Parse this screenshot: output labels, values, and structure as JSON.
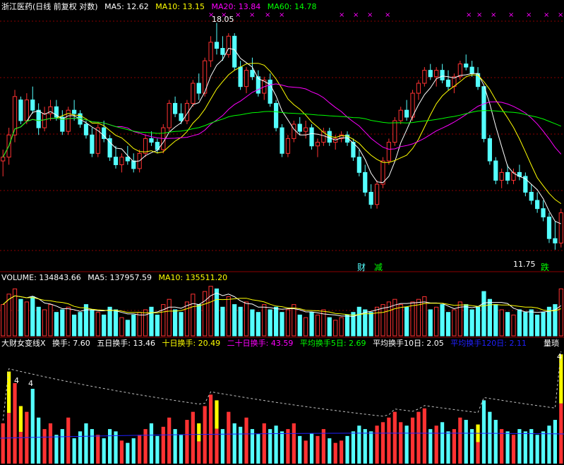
{
  "colors": {
    "background": "#000000",
    "bull": "#ff3232",
    "bear": "#54ffff",
    "white": "#ffffff",
    "yellow": "#ffff00",
    "magenta": "#ff00ff",
    "green": "#00ff00",
    "blue": "#2020ff",
    "grid": "#8b0000"
  },
  "main": {
    "title": "浙江医药(日线 前复权 对数)",
    "ma5": "MA5: 12.62",
    "ma10": "MA10: 13.15",
    "ma20": "MA20: 13.84",
    "ma60": "MA60: 14.78",
    "high_label": "18.05",
    "low_label": "11.75",
    "tag_cai": "财",
    "tag_jian": "减",
    "tag_die": "跌"
  },
  "volume": {
    "label": "VOLUME: 134843.66",
    "ma5": "MA5: 137957.59",
    "ma10": "MA10: 135511.20"
  },
  "turnover": {
    "title": "大财女变线X",
    "t1": "换手: 7.60",
    "t5": "五日换手: 13.46",
    "t10": "十日换手: 20.49",
    "t20": "二十日换手: 43.59",
    "avg5": "平均换手5日: 2.69",
    "avg10": "平均换手10日: 2.05",
    "avg120": "平均换手120日: 2.11",
    "right_label": "量琐",
    "mark_4": "4"
  },
  "chart_data": {
    "type": "candlestick",
    "price_high": 18.05,
    "price_low": 11.75,
    "candles": [
      [
        13.9,
        14.2,
        13.5,
        14.0
      ],
      [
        14.0,
        14.8,
        13.8,
        14.6
      ],
      [
        14.6,
        15.9,
        14.4,
        15.7
      ],
      [
        15.6,
        15.7,
        14.9,
        15.0
      ],
      [
        15.0,
        15.8,
        14.9,
        15.6
      ],
      [
        15.6,
        16.0,
        15.2,
        15.3
      ],
      [
        15.3,
        15.5,
        14.6,
        14.8
      ],
      [
        14.8,
        15.4,
        14.7,
        15.2
      ],
      [
        15.2,
        15.6,
        15.0,
        15.4
      ],
      [
        15.4,
        15.6,
        15.0,
        15.1
      ],
      [
        15.1,
        15.3,
        14.6,
        14.7
      ],
      [
        14.7,
        15.4,
        14.6,
        15.3
      ],
      [
        15.3,
        15.6,
        15.0,
        15.2
      ],
      [
        15.2,
        15.3,
        14.8,
        14.9
      ],
      [
        14.9,
        15.0,
        14.5,
        14.6
      ],
      [
        14.6,
        14.8,
        14.0,
        14.1
      ],
      [
        14.1,
        14.9,
        14.0,
        14.8
      ],
      [
        14.8,
        15.0,
        14.4,
        14.5
      ],
      [
        14.5,
        14.6,
        13.9,
        14.0
      ],
      [
        14.0,
        14.3,
        13.7,
        13.8
      ],
      [
        13.8,
        14.1,
        13.6,
        14.0
      ],
      [
        14.0,
        14.3,
        13.8,
        13.9
      ],
      [
        13.9,
        14.1,
        13.6,
        13.7
      ],
      [
        13.7,
        14.2,
        13.6,
        14.1
      ],
      [
        14.1,
        14.6,
        14.0,
        14.5
      ],
      [
        14.5,
        14.7,
        14.3,
        14.4
      ],
      [
        14.4,
        14.5,
        14.1,
        14.2
      ],
      [
        14.2,
        14.9,
        14.1,
        14.8
      ],
      [
        14.8,
        15.6,
        14.7,
        15.5
      ],
      [
        15.5,
        15.7,
        15.1,
        15.2
      ],
      [
        15.2,
        15.5,
        14.9,
        15.0
      ],
      [
        15.0,
        15.6,
        14.9,
        15.5
      ],
      [
        15.5,
        16.2,
        15.4,
        16.1
      ],
      [
        16.1,
        16.4,
        15.6,
        15.8
      ],
      [
        15.8,
        16.9,
        15.7,
        16.8
      ],
      [
        16.8,
        17.6,
        16.6,
        17.4
      ],
      [
        17.4,
        18.05,
        17.0,
        17.2
      ],
      [
        17.2,
        17.6,
        16.8,
        17.0
      ],
      [
        17.0,
        17.7,
        16.9,
        17.6
      ],
      [
        17.6,
        17.7,
        16.5,
        16.6
      ],
      [
        16.6,
        16.8,
        15.9,
        16.0
      ],
      [
        16.0,
        16.6,
        15.8,
        16.5
      ],
      [
        16.5,
        16.9,
        16.2,
        16.3
      ],
      [
        16.3,
        16.5,
        15.7,
        15.8
      ],
      [
        15.8,
        16.3,
        15.6,
        16.2
      ],
      [
        16.2,
        16.4,
        15.4,
        15.5
      ],
      [
        15.5,
        15.6,
        14.7,
        14.8
      ],
      [
        14.8,
        14.9,
        14.0,
        14.1
      ],
      [
        14.1,
        14.6,
        14.0,
        14.5
      ],
      [
        14.5,
        15.0,
        14.4,
        14.9
      ],
      [
        14.9,
        15.1,
        14.6,
        14.7
      ],
      [
        14.7,
        15.0,
        14.5,
        14.8
      ],
      [
        14.8,
        14.9,
        14.2,
        14.3
      ],
      [
        14.3,
        14.5,
        14.0,
        14.4
      ],
      [
        14.4,
        14.8,
        14.3,
        14.7
      ],
      [
        14.7,
        14.8,
        14.3,
        14.4
      ],
      [
        14.4,
        14.6,
        14.2,
        14.5
      ],
      [
        14.5,
        14.7,
        14.4,
        14.6
      ],
      [
        14.6,
        14.7,
        14.3,
        14.4
      ],
      [
        14.4,
        14.5,
        13.9,
        14.0
      ],
      [
        14.0,
        14.2,
        13.5,
        13.6
      ],
      [
        13.6,
        13.8,
        13.0,
        13.1
      ],
      [
        13.1,
        13.3,
        12.7,
        12.8
      ],
      [
        12.8,
        13.4,
        12.7,
        13.3
      ],
      [
        13.3,
        14.0,
        13.2,
        13.9
      ],
      [
        13.9,
        14.5,
        13.8,
        14.4
      ],
      [
        14.4,
        15.1,
        14.3,
        15.0
      ],
      [
        15.0,
        15.4,
        14.9,
        15.3
      ],
      [
        15.3,
        15.6,
        15.0,
        15.1
      ],
      [
        15.1,
        15.9,
        15.0,
        15.8
      ],
      [
        15.8,
        16.2,
        15.6,
        16.1
      ],
      [
        16.1,
        16.6,
        16.0,
        16.5
      ],
      [
        16.5,
        16.7,
        16.2,
        16.3
      ],
      [
        16.3,
        16.6,
        16.0,
        16.5
      ],
      [
        16.5,
        16.7,
        16.1,
        16.2
      ],
      [
        16.2,
        16.5,
        15.9,
        16.0
      ],
      [
        16.0,
        16.4,
        15.8,
        16.3
      ],
      [
        16.3,
        16.8,
        16.2,
        16.7
      ],
      [
        16.7,
        17.0,
        16.5,
        16.6
      ],
      [
        16.6,
        16.8,
        16.3,
        16.4
      ],
      [
        16.4,
        16.6,
        15.9,
        16.0
      ],
      [
        16.0,
        15.8,
        14.4,
        14.5
      ],
      [
        14.5,
        14.6,
        13.8,
        13.9
      ],
      [
        13.9,
        14.0,
        13.3,
        13.4
      ],
      [
        13.4,
        13.7,
        13.2,
        13.6
      ],
      [
        13.6,
        13.8,
        13.3,
        13.4
      ],
      [
        13.4,
        13.7,
        13.3,
        13.6
      ],
      [
        13.6,
        13.8,
        13.4,
        13.5
      ],
      [
        13.5,
        13.6,
        13.0,
        13.1
      ],
      [
        13.1,
        13.3,
        12.8,
        12.9
      ],
      [
        12.9,
        13.1,
        12.6,
        12.7
      ],
      [
        12.7,
        12.9,
        12.4,
        12.5
      ],
      [
        12.5,
        12.6,
        11.9,
        12.0
      ],
      [
        12.0,
        12.4,
        11.75,
        11.9
      ],
      [
        11.9,
        12.7,
        11.8,
        12.6
      ]
    ],
    "volume": [
      0.6,
      0.8,
      0.9,
      0.7,
      0.65,
      0.75,
      0.55,
      0.5,
      0.6,
      0.45,
      0.5,
      0.55,
      0.4,
      0.45,
      0.6,
      0.5,
      0.45,
      0.4,
      0.55,
      0.5,
      0.35,
      0.3,
      0.4,
      0.45,
      0.5,
      0.55,
      0.4,
      0.6,
      0.7,
      0.5,
      0.45,
      0.65,
      0.8,
      0.6,
      0.85,
      0.95,
      0.9,
      0.55,
      0.75,
      0.6,
      0.55,
      0.65,
      0.5,
      0.45,
      0.6,
      0.5,
      0.55,
      0.45,
      0.5,
      0.6,
      0.4,
      0.35,
      0.45,
      0.4,
      0.5,
      0.35,
      0.3,
      0.35,
      0.4,
      0.45,
      0.55,
      0.5,
      0.45,
      0.55,
      0.6,
      0.65,
      0.7,
      0.6,
      0.55,
      0.65,
      0.7,
      0.75,
      0.5,
      0.55,
      0.6,
      0.45,
      0.5,
      0.65,
      0.6,
      0.5,
      0.55,
      0.85,
      0.7,
      0.6,
      0.5,
      0.45,
      0.4,
      0.5,
      0.45,
      0.5,
      0.4,
      0.45,
      0.55,
      0.6,
      0.9
    ],
    "turnover": [
      0.35,
      0.8,
      0.7,
      0.5,
      0.45,
      0.65,
      0.4,
      0.3,
      0.35,
      0.25,
      0.3,
      0.4,
      0.22,
      0.28,
      0.35,
      0.3,
      0.25,
      0.22,
      0.3,
      0.28,
      0.2,
      0.18,
      0.22,
      0.25,
      0.3,
      0.35,
      0.24,
      0.32,
      0.4,
      0.3,
      0.25,
      0.38,
      0.45,
      0.35,
      0.5,
      0.6,
      0.55,
      0.3,
      0.45,
      0.35,
      0.32,
      0.4,
      0.3,
      0.26,
      0.35,
      0.3,
      0.33,
      0.28,
      0.3,
      0.35,
      0.24,
      0.2,
      0.26,
      0.24,
      0.3,
      0.22,
      0.18,
      0.2,
      0.24,
      0.28,
      0.33,
      0.3,
      0.28,
      0.33,
      0.36,
      0.4,
      0.45,
      0.36,
      0.33,
      0.4,
      0.45,
      0.48,
      0.3,
      0.33,
      0.36,
      0.28,
      0.3,
      0.4,
      0.38,
      0.3,
      0.34,
      0.55,
      0.45,
      0.38,
      0.3,
      0.28,
      0.25,
      0.3,
      0.28,
      0.3,
      0.25,
      0.28,
      0.33,
      0.38,
      0.95
    ],
    "signals": [
      1,
      3,
      33,
      36,
      80,
      94
    ]
  }
}
